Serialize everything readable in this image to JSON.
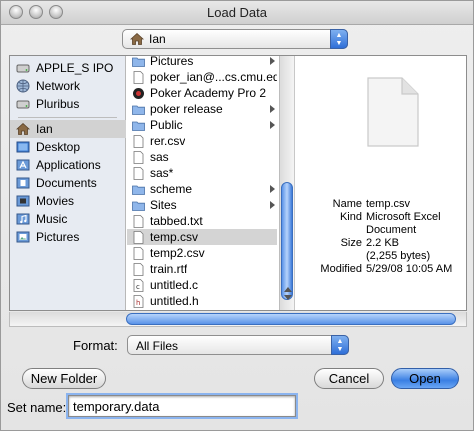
{
  "window": {
    "title": "Load Data"
  },
  "location": {
    "current": "Ian"
  },
  "sidebar": {
    "devices": [
      {
        "label": "APPLE_S IPO",
        "icon": "disk-icon"
      },
      {
        "label": "Network",
        "icon": "network-icon"
      },
      {
        "label": "Pluribus",
        "icon": "disk-icon"
      }
    ],
    "places": [
      {
        "label": "Ian",
        "icon": "home-icon",
        "selected": true
      },
      {
        "label": "Desktop",
        "icon": "desktop-icon"
      },
      {
        "label": "Applications",
        "icon": "applications-icon"
      },
      {
        "label": "Documents",
        "icon": "documents-icon"
      },
      {
        "label": "Movies",
        "icon": "movies-icon"
      },
      {
        "label": "Music",
        "icon": "music-icon"
      },
      {
        "label": "Pictures",
        "icon": "pictures-icon"
      }
    ]
  },
  "files": [
    {
      "name": "Pictures",
      "icon": "folder-icon",
      "folder": true
    },
    {
      "name": "poker_ian@...cs.cmu.edu",
      "icon": "document-icon",
      "folder": false
    },
    {
      "name": "Poker Academy Pro 2",
      "icon": "app-icon",
      "folder": false
    },
    {
      "name": "poker release",
      "icon": "folder-icon",
      "folder": true
    },
    {
      "name": "Public",
      "icon": "folder-icon",
      "folder": true
    },
    {
      "name": "rer.csv",
      "icon": "document-icon",
      "folder": false
    },
    {
      "name": "sas",
      "icon": "document-icon",
      "folder": false
    },
    {
      "name": "sas*",
      "icon": "document-icon",
      "folder": false
    },
    {
      "name": "scheme",
      "icon": "folder-icon",
      "folder": true
    },
    {
      "name": "Sites",
      "icon": "folder-icon",
      "folder": true
    },
    {
      "name": "tabbed.txt",
      "icon": "document-icon",
      "folder": false
    },
    {
      "name": "temp.csv",
      "icon": "document-icon",
      "folder": false,
      "selected": true
    },
    {
      "name": "temp2.csv",
      "icon": "document-icon",
      "folder": false
    },
    {
      "name": "train.rtf",
      "icon": "document-icon",
      "folder": false
    },
    {
      "name": "untitled.c",
      "icon": "c-file-icon",
      "folder": false
    },
    {
      "name": "untitled.h",
      "icon": "h-file-icon",
      "folder": false
    }
  ],
  "preview": {
    "name_label": "Name",
    "name": "temp.csv",
    "kind_label": "Kind",
    "kind": "Microsoft Excel",
    "kind_line2": "Document",
    "size_label": "Size",
    "size": "2.2 KB",
    "size_bytes": "(2,255 bytes)",
    "modified_label": "Modified",
    "modified": "5/29/08 10:05 AM"
  },
  "format": {
    "label": "Format:",
    "value": "All Files"
  },
  "buttons": {
    "new_folder": "New Folder",
    "cancel": "Cancel",
    "open": "Open"
  },
  "set_name": {
    "label": "Set name:",
    "value": "temporary.data"
  }
}
